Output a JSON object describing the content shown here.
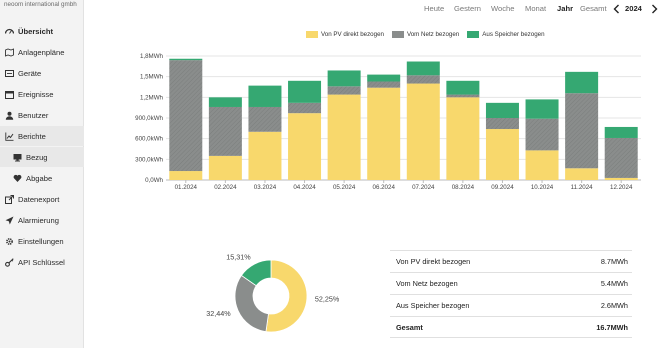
{
  "brand": "neoom international gmbh",
  "sidebar": {
    "items": [
      {
        "label": "Übersicht",
        "icon": "dashboard-icon",
        "active": true
      },
      {
        "label": "Anlagenpläne",
        "icon": "map-icon"
      },
      {
        "label": "Geräte",
        "icon": "device-icon"
      },
      {
        "label": "Ereignisse",
        "icon": "calendar-icon"
      },
      {
        "label": "Benutzer",
        "icon": "user-icon"
      },
      {
        "label": "Berichte",
        "icon": "chart-line-icon"
      },
      {
        "label": "Bezug",
        "icon": "monitor-icon",
        "sub": true
      },
      {
        "label": "Abgabe",
        "icon": "heart-icon",
        "sub": true
      },
      {
        "label": "Datenexport",
        "icon": "export-icon"
      },
      {
        "label": "Alarmierung",
        "icon": "alarm-icon"
      },
      {
        "label": "Einstellungen",
        "icon": "gear-icon"
      },
      {
        "label": "API Schlüssel",
        "icon": "key-icon"
      }
    ]
  },
  "period_nav": {
    "tabs": [
      "Heute",
      "Gestern",
      "Woche",
      "Monat",
      "Jahr",
      "Gesamt"
    ],
    "selected": "Jahr",
    "year": "2024",
    "prev_icon": "chevron-left-icon",
    "next_icon": "chevron-right-icon"
  },
  "colors": {
    "pv": "#f8d86c",
    "netz": "#8a8d8c",
    "speicher": "#35a872"
  },
  "chart_data": {
    "type": "bar",
    "stacked": true,
    "categories": [
      "01.2024",
      "02.2024",
      "03.2024",
      "04.2024",
      "05.2024",
      "06.2024",
      "07.2024",
      "08.2024",
      "09.2024",
      "10.2024",
      "11.2024",
      "12.2024"
    ],
    "series": [
      {
        "name": "Von PV direkt bezogen",
        "values": [
          0.13,
          0.35,
          0.7,
          0.97,
          1.24,
          1.34,
          1.4,
          1.2,
          0.74,
          0.43,
          0.17,
          0.03
        ]
      },
      {
        "name": "Vom Netz bezogen",
        "values": [
          1.61,
          0.71,
          0.36,
          0.15,
          0.12,
          0.09,
          0.12,
          0.04,
          0.16,
          0.46,
          1.09,
          0.58
        ]
      },
      {
        "name": "Aus Speicher bezogen",
        "values": [
          0.02,
          0.14,
          0.31,
          0.32,
          0.23,
          0.1,
          0.2,
          0.2,
          0.22,
          0.28,
          0.31,
          0.16
        ]
      }
    ],
    "yticks": [
      "0,0Wh",
      "300,0kWh",
      "600,0kWh",
      "900,0kWh",
      "1,2MWh",
      "1,5MWh",
      "1,8MWh"
    ],
    "ylim": [
      0,
      1.8
    ],
    "grid": true,
    "legend_position": "top"
  },
  "donut": {
    "labels": [
      "52,25%",
      "32,44%",
      "15,31%"
    ],
    "values": [
      52.25,
      32.44,
      15.31
    ]
  },
  "summary": {
    "rows": [
      {
        "label": "Von PV direkt bezogen",
        "value": "8.7MWh"
      },
      {
        "label": "Vom Netz bezogen",
        "value": "5.4MWh"
      },
      {
        "label": "Aus Speicher bezogen",
        "value": "2.6MWh"
      },
      {
        "label": "Gesamt",
        "value": "16.7MWh"
      }
    ]
  }
}
